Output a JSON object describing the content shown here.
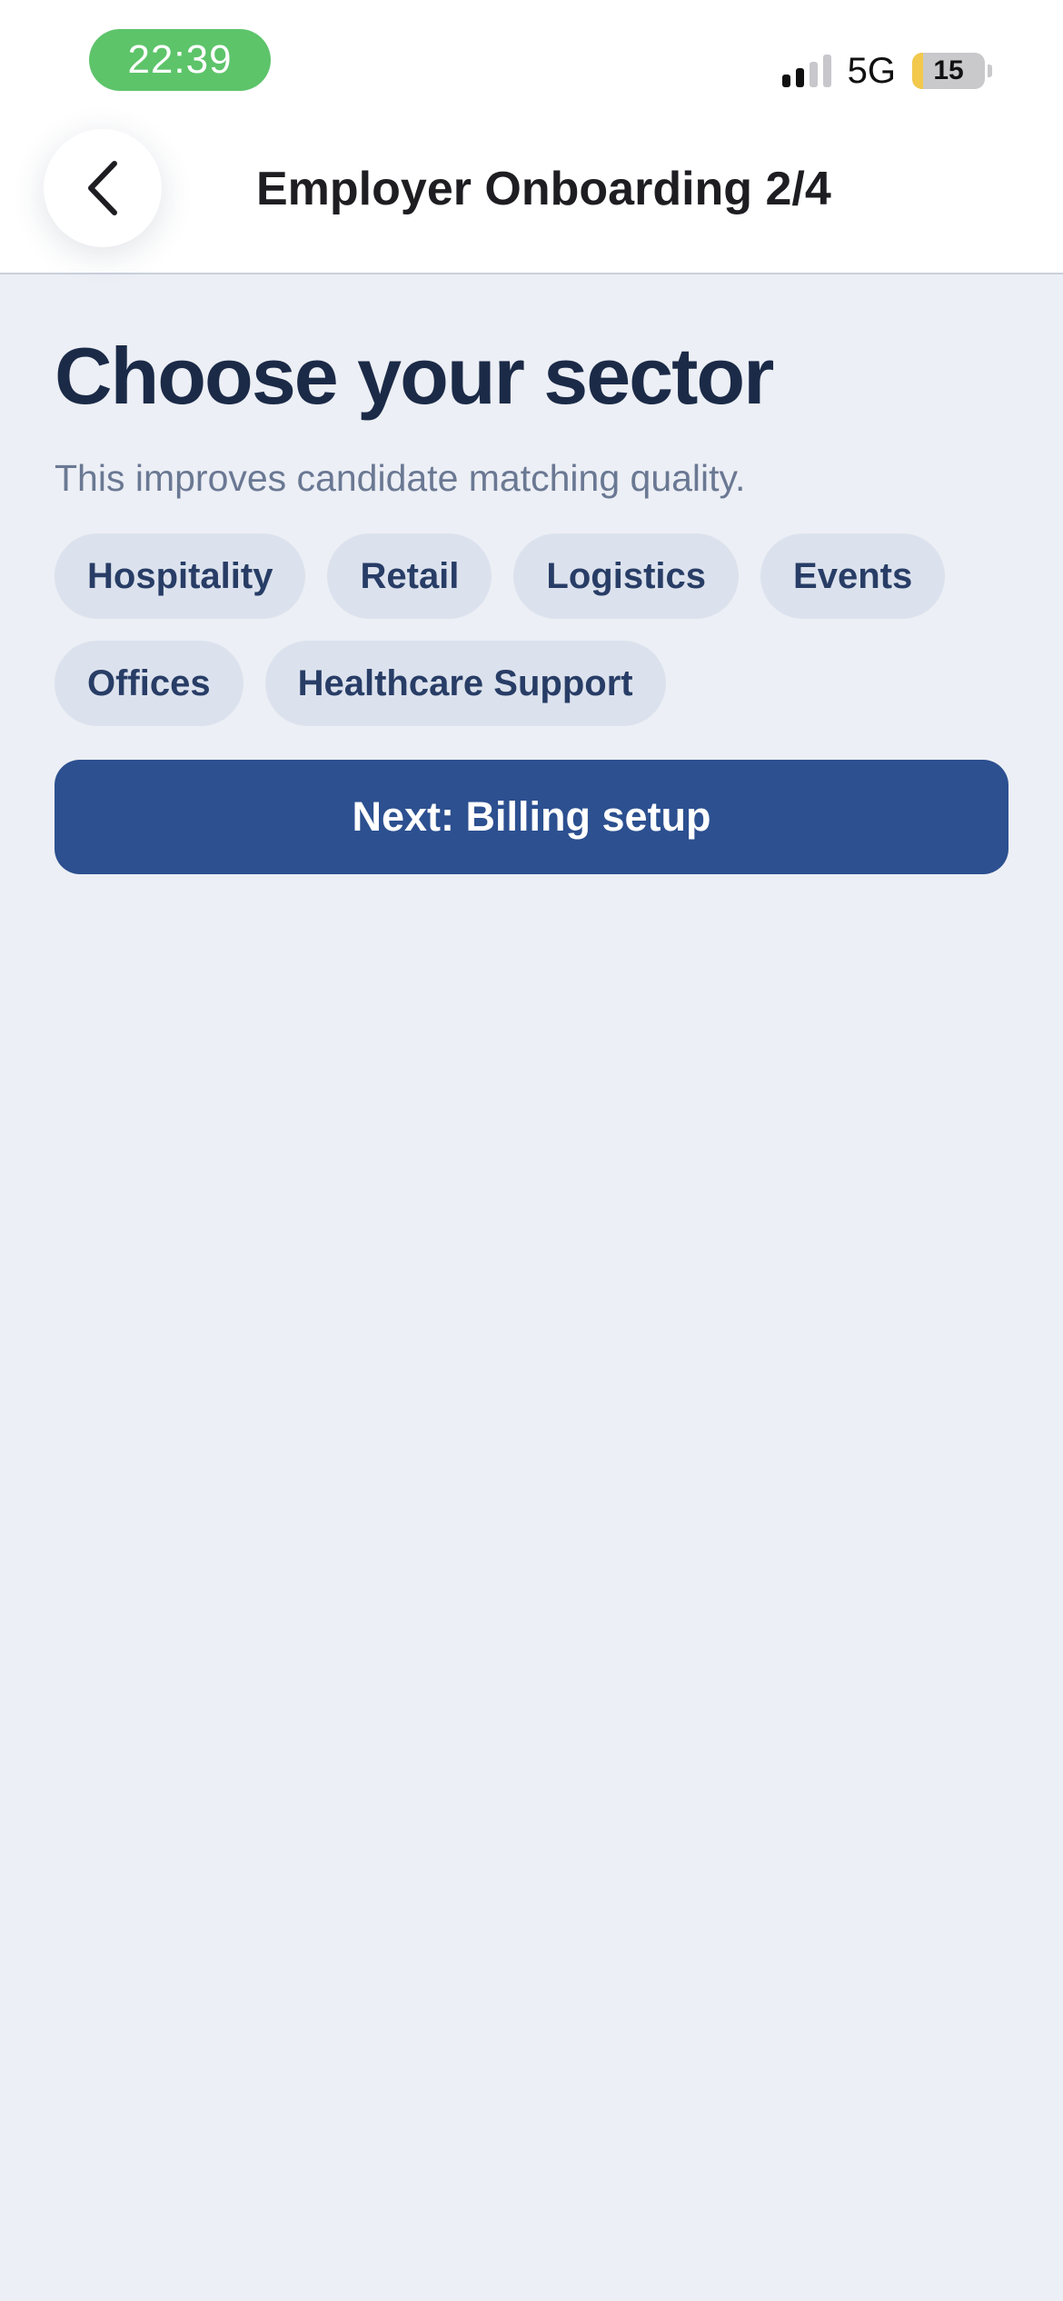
{
  "status_bar": {
    "time": "22:39",
    "network": "5G",
    "battery": "15",
    "battery_level_percent": 15,
    "signal_bars_active": 2,
    "signal_bars_total": 4,
    "time_pill_color": "#5DC46A",
    "battery_fill_color": "#F2C94C"
  },
  "nav": {
    "back_icon": "chevron-left-icon",
    "title": "Employer Onboarding 2/4"
  },
  "content": {
    "heading": "Choose your sector",
    "subtitle": "This improves candidate matching quality.",
    "sectors": [
      "Hospitality",
      "Retail",
      "Logistics",
      "Events",
      "Offices",
      "Healthcare Support"
    ],
    "next_button": "Next: Billing setup"
  },
  "colors": {
    "background": "#ECEFF5",
    "heading": "#1B2A47",
    "subtitle": "#6A7893",
    "chip_background": "#DCE2ED",
    "chip_text": "#283D66",
    "primary_button": "#2C5090"
  }
}
